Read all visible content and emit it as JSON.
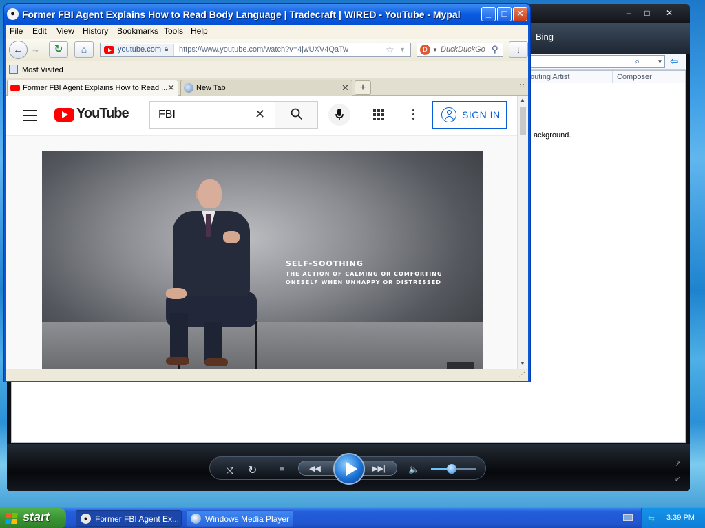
{
  "wmp": {
    "controls": {
      "minimize": "–",
      "maximize": "□",
      "close": "✕"
    },
    "nav_label": "Bing",
    "search_icon": "⌕",
    "back_arrow": "⇦",
    "columns": [
      "outing Artist",
      "Composer"
    ],
    "background_text": "ackground.",
    "playback": {
      "shuffle": "⤨",
      "repeat": "↻",
      "stop": "■",
      "prev": "|◀◀",
      "next": "▶▶|",
      "volume": "🔈",
      "volume_level": 0.45,
      "fullscreen": "↗",
      "switch_view": "↙"
    }
  },
  "browser": {
    "title": "Former FBI Agent Explains How to Read Body Language | Tradecraft | WIRED - YouTube - Mypal",
    "title_buttons": {
      "minimize": "_",
      "maximize": "□",
      "close": "✕"
    },
    "menu": [
      "File",
      "Edit",
      "View",
      "History",
      "Bookmarks",
      "Tools",
      "Help"
    ],
    "nav": {
      "back": "←",
      "forward": "→",
      "reload": "↻",
      "home": "⌂",
      "download": "↓"
    },
    "url_domain": "youtube.com",
    "url": "https://www.youtube.com/watch?v=4jwUXV4QaTw",
    "search_engine_label": "D",
    "search_placeholder": "DuckDuckGo",
    "bookmarks": {
      "most_visited": "Most Visited"
    },
    "tabs": [
      {
        "label": "Former FBI Agent Explains How to Read ...",
        "active": true
      },
      {
        "label": "New Tab",
        "active": false
      }
    ],
    "tab_close": "✕",
    "new_tab": "+",
    "tab_list": "∷"
  },
  "youtube": {
    "logo_text": "YouTube",
    "search_value": "FBI",
    "clear_icon": "✕",
    "sign_in": "SIGN IN",
    "caption": {
      "title": "SELF-SOOTHING",
      "lines": [
        "THE ACTION OF CALMING OR COMFORTING",
        "ONESELF WHEN UNHAPPY OR DISTRESSED"
      ]
    },
    "scroll_up": "▲",
    "scroll_down": "▼"
  },
  "taskbar": {
    "start": "start",
    "buttons": [
      {
        "label": "Former FBI Agent Ex...",
        "active": true
      },
      {
        "label": "Windows Media Player",
        "active": false
      }
    ],
    "time": "3:39 PM"
  },
  "colors": {
    "xp_blue": "#0a58d6",
    "youtube_red": "#ff0000",
    "signin_blue": "#065fd4",
    "start_green": "#3a9533"
  }
}
